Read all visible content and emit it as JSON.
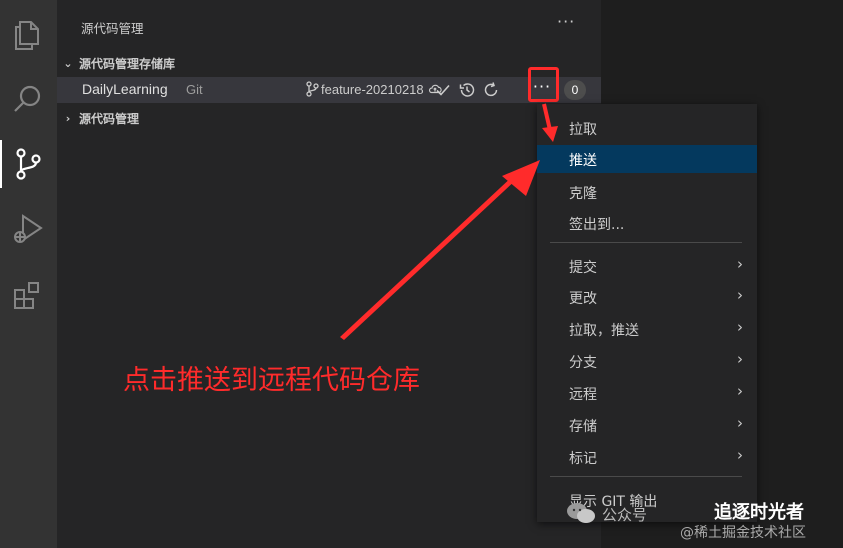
{
  "activity_bar": {
    "items": [
      {
        "icon": "files-icon"
      },
      {
        "icon": "search-icon"
      },
      {
        "icon": "source-control-icon"
      },
      {
        "icon": "run-debug-icon"
      },
      {
        "icon": "extensions-icon"
      }
    ]
  },
  "panel": {
    "title": "源代码管理",
    "more": "···"
  },
  "sections": {
    "repositories": "源代码管理存储库",
    "source_control": "源代码管理"
  },
  "repo": {
    "name": "DailyLearning",
    "type": "Git",
    "branch": "feature-20210218",
    "more": "···",
    "count": "0"
  },
  "menu": {
    "items": [
      {
        "label": "拉取",
        "submenu": false
      },
      {
        "label": "推送",
        "submenu": false,
        "active": true
      },
      {
        "label": "克隆",
        "submenu": false
      },
      {
        "label": "签出到...",
        "submenu": false
      },
      {
        "label": "提交",
        "submenu": true
      },
      {
        "label": "更改",
        "submenu": true
      },
      {
        "label": "拉取，推送",
        "submenu": true
      },
      {
        "label": "分支",
        "submenu": true
      },
      {
        "label": "远程",
        "submenu": true
      },
      {
        "label": "存储",
        "submenu": true
      },
      {
        "label": "标记",
        "submenu": true
      },
      {
        "label": "显示 GIT 输出",
        "submenu": false
      }
    ],
    "submenu_glyph": "›"
  },
  "annotation": {
    "text": "点击推送到远程代码仓库",
    "color": "#ff2b2b"
  },
  "watermark": {
    "public_label": "公众号",
    "name": "追逐时光者",
    "site": "@稀土掘金技术社区"
  },
  "colors": {
    "accent_active": "#04395e",
    "annotation": "#ff2b2b"
  }
}
